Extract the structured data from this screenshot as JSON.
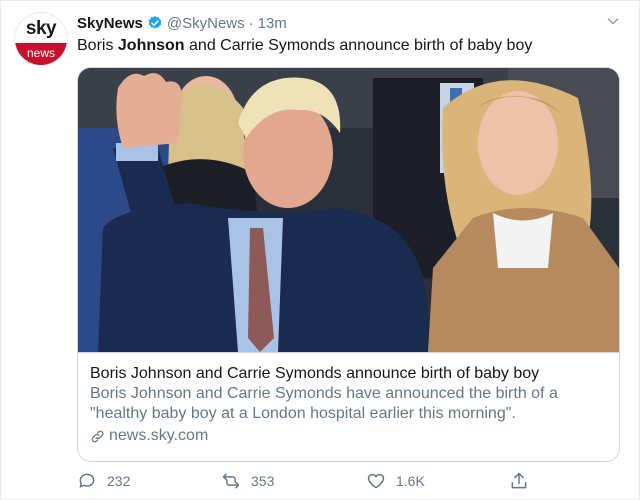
{
  "account": {
    "avatar_top": "sky",
    "avatar_bottom": "news",
    "name": "SkyNews",
    "handle": "@SkyNews",
    "separator": "·",
    "time": "13m"
  },
  "tweet": {
    "text_before": "Boris ",
    "text_bold": "Johnson",
    "text_after": " and Carrie Symonds announce birth of baby boy"
  },
  "card": {
    "title": "Boris Johnson and Carrie Symonds announce birth of baby boy",
    "description": "Boris Johnson and Carrie Symonds have announced the birth of a \"healthy baby boy at a London hospital earlier this morning\".",
    "domain": "news.sky.com"
  },
  "actions": {
    "replies": "232",
    "retweets": "353",
    "likes": "1.6K"
  },
  "colors": {
    "verified": "#1da1f2",
    "sky_red": "#c8102e",
    "muted": "#657786"
  }
}
